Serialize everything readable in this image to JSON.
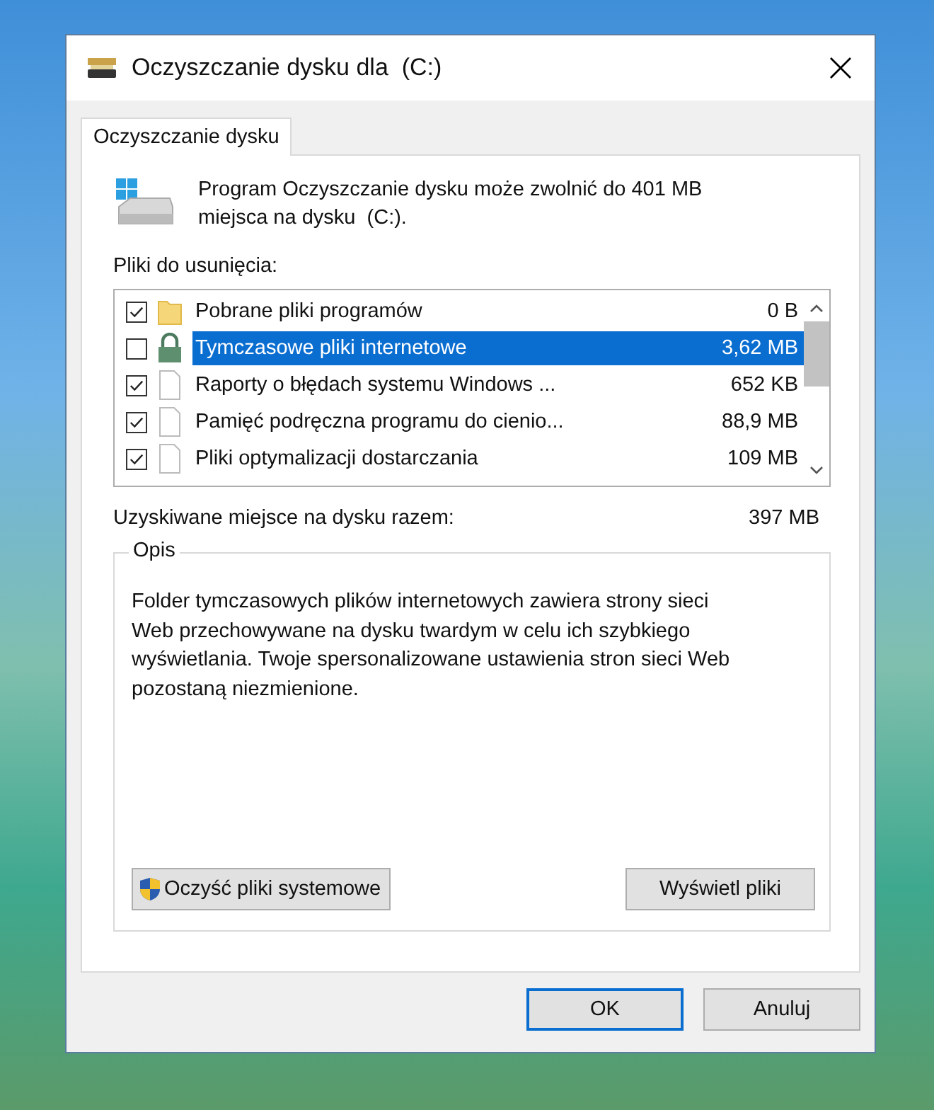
{
  "window": {
    "title": "Oczyszczanie dysku dla  (C:)"
  },
  "tabs": [
    {
      "label": "Oczyszczanie dysku",
      "selected": true
    }
  ],
  "intro": "Program Oczyszczanie dysku może zwolnić do 401 MB miejsca na dysku  (C:).",
  "files_label": "Pliki do usunięcia:",
  "files": [
    {
      "kind": "folder",
      "name": "Pobrane pliki programów",
      "size": "0 B",
      "checked": true,
      "selected": false
    },
    {
      "kind": "lock",
      "name": "Tymczasowe pliki internetowe",
      "size": "3,62 MB",
      "checked": false,
      "selected": true
    },
    {
      "kind": "file",
      "name": "Raporty o błędach systemu Windows ...",
      "size": "652 KB",
      "checked": true,
      "selected": false
    },
    {
      "kind": "file",
      "name": "Pamięć podręczna programu do cienio...",
      "size": "88,9 MB",
      "checked": true,
      "selected": false
    },
    {
      "kind": "file",
      "name": "Pliki optymalizacji dostarczania",
      "size": "109 MB",
      "checked": true,
      "selected": false
    }
  ],
  "total": {
    "label": "Uzyskiwane miejsce na dysku razem:",
    "value": "397 MB"
  },
  "description": {
    "title": "Opis",
    "text": "Folder tymczasowych plików internetowych zawiera strony sieci Web przechowywane na dysku twardym w celu ich szybkiego wyświetlania. Twoje spersonalizowane ustawienia stron sieci Web pozostaną niezmienione."
  },
  "actions": [
    {
      "kind": "shield",
      "label": "Oczyść pliki systemowe"
    },
    {
      "kind": "plain",
      "label": "Wyświetl pliki"
    }
  ],
  "buttons": [
    {
      "label": "OK",
      "default": true
    },
    {
      "label": "Anuluj",
      "default": false
    }
  ]
}
